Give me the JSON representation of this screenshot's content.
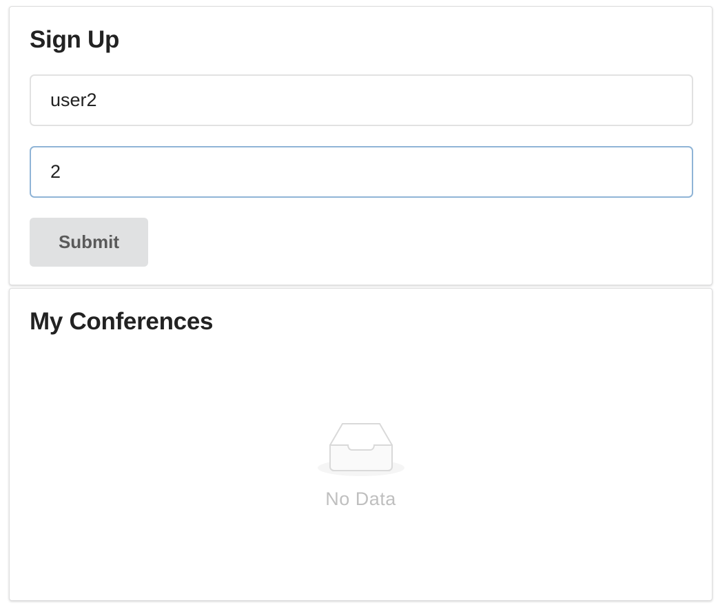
{
  "signup": {
    "title": "Sign Up",
    "username_value": "user2",
    "password_value": "2",
    "submit_label": "Submit"
  },
  "conferences": {
    "title": "My Conferences",
    "empty_text": "No Data",
    "empty_icon": "inbox-empty-icon"
  },
  "colors": {
    "focus_border": "#8fb4d6",
    "button_bg": "#e0e1e2",
    "title_text": "#222222"
  }
}
